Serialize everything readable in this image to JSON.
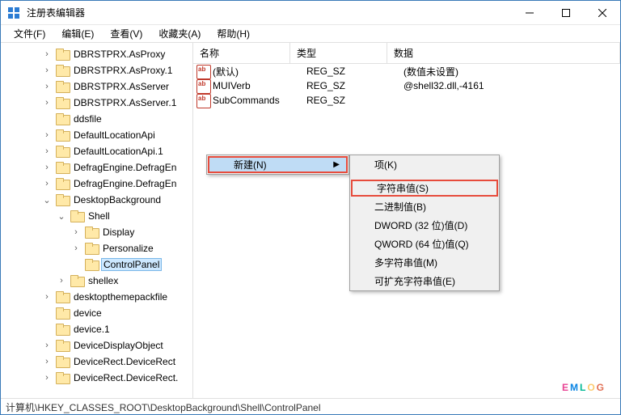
{
  "window": {
    "title": "注册表编辑器"
  },
  "menubar": {
    "file": "文件(F)",
    "edit": "编辑(E)",
    "view": "查看(V)",
    "favorites": "收藏夹(A)",
    "help": "帮助(H)"
  },
  "tree": [
    {
      "level": 2,
      "exp": ">",
      "label": "DBRSTPRX.AsProxy"
    },
    {
      "level": 2,
      "exp": ">",
      "label": "DBRSTPRX.AsProxy.1"
    },
    {
      "level": 2,
      "exp": ">",
      "label": "DBRSTPRX.AsServer"
    },
    {
      "level": 2,
      "exp": ">",
      "label": "DBRSTPRX.AsServer.1"
    },
    {
      "level": 2,
      "exp": "",
      "label": "ddsfile"
    },
    {
      "level": 2,
      "exp": ">",
      "label": "DefaultLocationApi"
    },
    {
      "level": 2,
      "exp": ">",
      "label": "DefaultLocationApi.1"
    },
    {
      "level": 2,
      "exp": ">",
      "label": "DefragEngine.DefragEn"
    },
    {
      "level": 2,
      "exp": ">",
      "label": "DefragEngine.DefragEn"
    },
    {
      "level": 2,
      "exp": "v",
      "label": "DesktopBackground"
    },
    {
      "level": 3,
      "exp": "v",
      "label": "Shell"
    },
    {
      "level": 4,
      "exp": ">",
      "label": "Display"
    },
    {
      "level": 4,
      "exp": ">",
      "label": "Personalize"
    },
    {
      "level": 4,
      "exp": "",
      "label": "ControlPanel",
      "selected": true
    },
    {
      "level": 3,
      "exp": ">",
      "label": "shellex"
    },
    {
      "level": 2,
      "exp": ">",
      "label": "desktopthemepackfile"
    },
    {
      "level": 2,
      "exp": "",
      "label": "device"
    },
    {
      "level": 2,
      "exp": "",
      "label": "device.1"
    },
    {
      "level": 2,
      "exp": ">",
      "label": "DeviceDisplayObject"
    },
    {
      "level": 2,
      "exp": ">",
      "label": "DeviceRect.DeviceRect"
    },
    {
      "level": 2,
      "exp": ">",
      "label": "DeviceRect.DeviceRect."
    }
  ],
  "list": {
    "headers": {
      "name": "名称",
      "type": "类型",
      "data": "数据"
    },
    "rows": [
      {
        "name": "(默认)",
        "type": "REG_SZ",
        "data": "(数值未设置)"
      },
      {
        "name": "MUIVerb",
        "type": "REG_SZ",
        "data": "@shell32.dll,-4161"
      },
      {
        "name": "SubCommands",
        "type": "REG_SZ",
        "data": ""
      }
    ]
  },
  "context_menu": {
    "new": "新建(N)",
    "sub": {
      "key": "项(K)",
      "string": "字符串值(S)",
      "binary": "二进制值(B)",
      "dword": "DWORD (32 位)值(D)",
      "qword": "QWORD (64 位)值(Q)",
      "multi": "多字符串值(M)",
      "expand": "可扩充字符串值(E)"
    }
  },
  "statusbar": "计算机\\HKEY_CLASSES_ROOT\\DesktopBackground\\Shell\\ControlPanel",
  "watermark": "EMLOG"
}
